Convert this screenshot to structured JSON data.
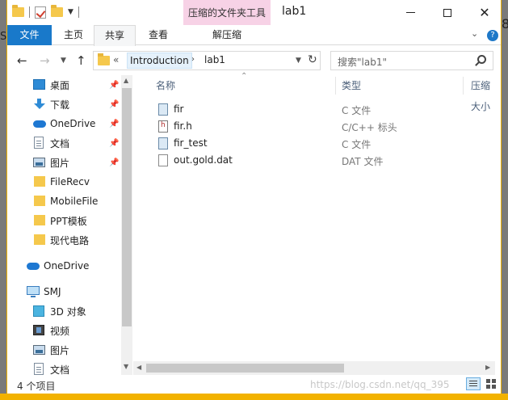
{
  "window": {
    "title": "lab1",
    "contextual_group": "压缩的文件夹工具",
    "buttons": {
      "minimize": "minimize",
      "maximize": "maximize",
      "close": "✕"
    }
  },
  "ribbon": {
    "tabs": {
      "file": "文件",
      "home": "主页",
      "share": "共享",
      "view": "查看",
      "decompress": "解压缩"
    }
  },
  "address": {
    "prefix": "«",
    "crumbs": [
      "Introduction",
      "lab1"
    ],
    "separator": "›",
    "search_placeholder": "搜索\"lab1\""
  },
  "columns": {
    "name": "名称",
    "type": "类型",
    "compressed_size": "压缩大小"
  },
  "nav": {
    "items": [
      {
        "label": "桌面",
        "icon": "desktop-icon",
        "pinned": true
      },
      {
        "label": "下载",
        "icon": "download-icon",
        "pinned": true
      },
      {
        "label": "OneDrive",
        "icon": "onedrive-icon",
        "pinned": true
      },
      {
        "label": "文档",
        "icon": "documents-icon",
        "pinned": true
      },
      {
        "label": "图片",
        "icon": "pictures-icon",
        "pinned": true
      },
      {
        "label": "FileRecv",
        "icon": "folder-icon",
        "pinned": false
      },
      {
        "label": "MobileFile",
        "icon": "folder-icon",
        "pinned": false
      },
      {
        "label": "PPT模板",
        "icon": "folder-icon",
        "pinned": false
      },
      {
        "label": "现代电路",
        "icon": "folder-icon",
        "pinned": false
      }
    ],
    "onedrive": "OneDrive",
    "pc": "SMJ",
    "pc_items": [
      {
        "label": "3D 对象",
        "icon": "3d-objects-icon"
      },
      {
        "label": "视频",
        "icon": "videos-icon"
      },
      {
        "label": "图片",
        "icon": "pictures-icon"
      },
      {
        "label": "文档",
        "icon": "documents-icon"
      }
    ]
  },
  "files": [
    {
      "name": "fir",
      "type": "C 文件",
      "icon": "c-file-icon"
    },
    {
      "name": "fir.h",
      "type": "C/C++ 标头",
      "icon": "header-file-icon"
    },
    {
      "name": "fir_test",
      "type": "C 文件",
      "icon": "c-file-icon"
    },
    {
      "name": "out.gold.dat",
      "type": "DAT 文件",
      "icon": "dat-file-icon"
    }
  ],
  "status": {
    "count": "4 个项目",
    "watermark": "https://blog.csdn.net/qq_395"
  },
  "background": {
    "left_char": "S",
    "right_char": "8"
  },
  "colors": {
    "accent": "#1979ca",
    "contextual_tab": "#f7d2e6",
    "frame": "#f2b200"
  }
}
